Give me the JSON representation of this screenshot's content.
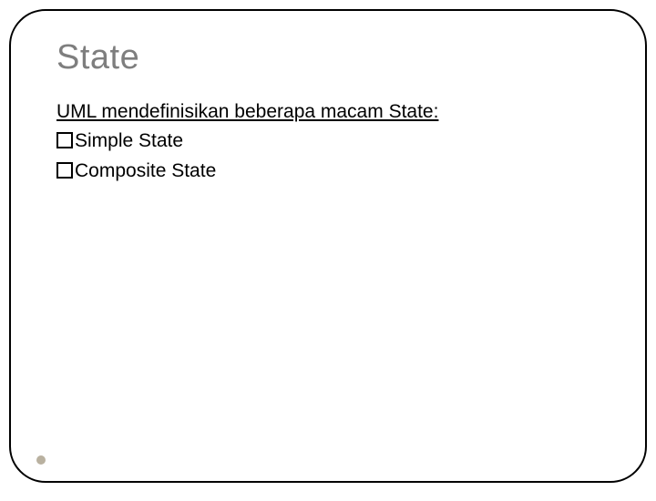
{
  "slide": {
    "title": "State",
    "intro": "UML mendefinisikan beberapa macam State:",
    "bullets": [
      "Simple State",
      "Composite State"
    ]
  }
}
